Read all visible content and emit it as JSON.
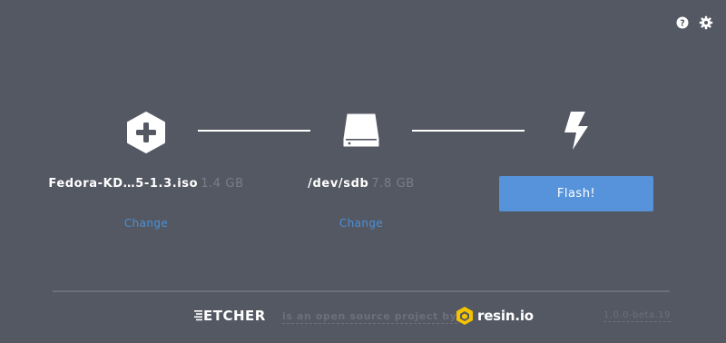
{
  "header": {
    "help_icon": "question-circle-icon",
    "settings_icon": "gear-icon"
  },
  "steps": {
    "image": {
      "icon": "plus-hexagon-icon",
      "name": "Fedora-KD…5-1.3.iso",
      "size": "1.4 GB",
      "change_label": "Change"
    },
    "drive": {
      "icon": "hard-drive-icon",
      "name": "/dev/sdb",
      "size": "7.8 GB",
      "change_label": "Change"
    },
    "flash": {
      "icon": "lightning-bolt-icon",
      "button_label": "Flash!"
    }
  },
  "footer": {
    "app_name": "ETCHER",
    "tagline": "is an open source project by",
    "company_name": "resin.io",
    "version": "1.0.0-beta.19"
  },
  "colors": {
    "background": "#545863",
    "accent": "#5793db",
    "link": "#4a90d9",
    "muted": "#7a7e88"
  }
}
